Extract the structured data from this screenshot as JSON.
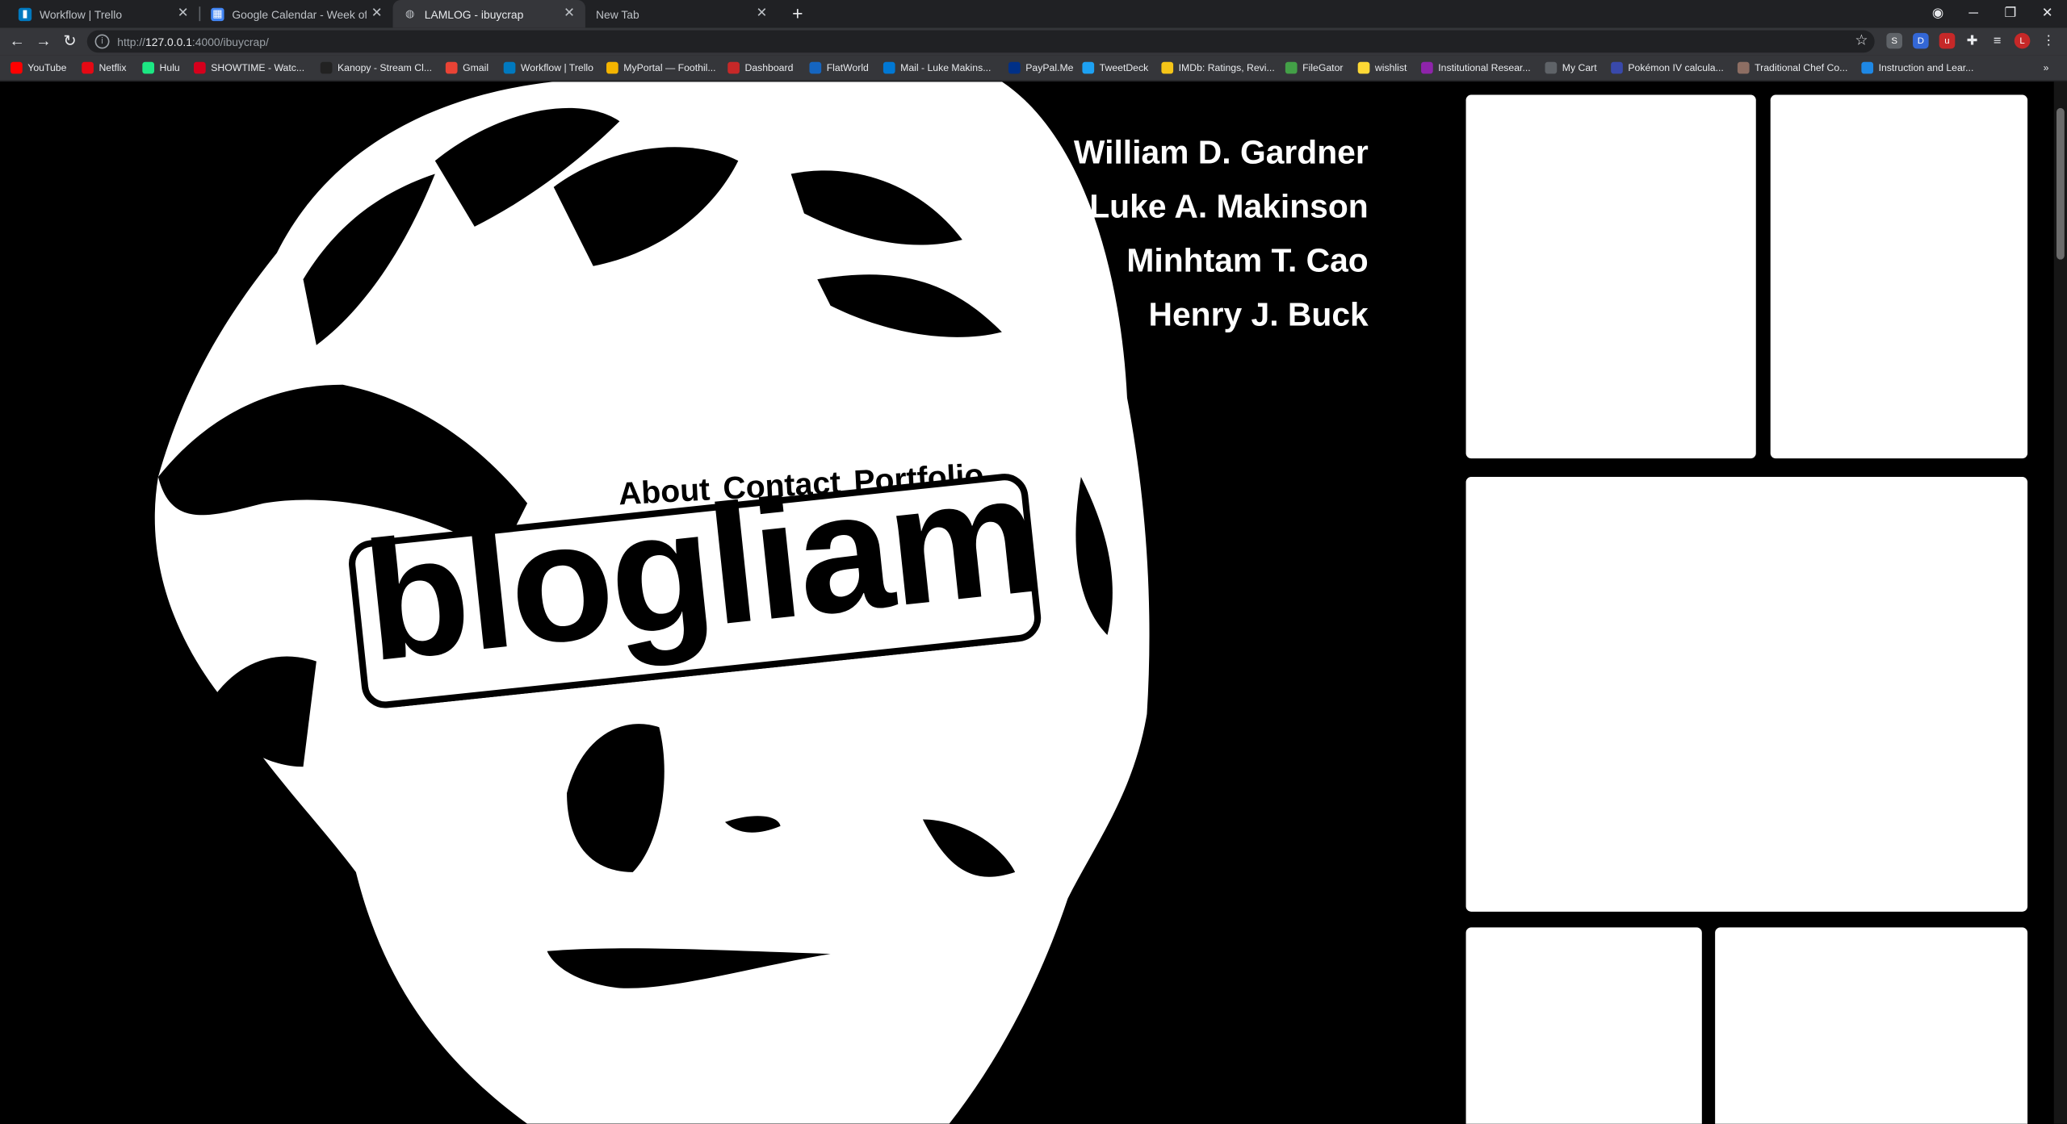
{
  "browser": {
    "tabs": [
      {
        "title": "Workflow | Trello",
        "active": false
      },
      {
        "title": "Google Calendar - Week of April",
        "active": false
      },
      {
        "title": "LAMLOG - ibuycrap",
        "active": true
      },
      {
        "title": "New Tab",
        "active": false
      }
    ],
    "url_host": "127.0.0.1",
    "url_rest": ":4000/ibuycrap/",
    "url_prefix": "http://",
    "bookmarks": [
      {
        "label": "YouTube",
        "color": "#ff0000"
      },
      {
        "label": "Netflix",
        "color": "#e50914"
      },
      {
        "label": "Hulu",
        "color": "#1ce783"
      },
      {
        "label": "SHOWTIME - Watc...",
        "color": "#d6001c"
      },
      {
        "label": "Kanopy - Stream Cl...",
        "color": "#222222"
      },
      {
        "label": "Gmail",
        "color": "#ea4335"
      },
      {
        "label": "Workflow | Trello",
        "color": "#0079bf"
      },
      {
        "label": "MyPortal — Foothil...",
        "color": "#f4b400"
      },
      {
        "label": "Dashboard",
        "color": "#c62828"
      },
      {
        "label": "FlatWorld",
        "color": "#1565c0"
      },
      {
        "label": "Mail - Luke Makins...",
        "color": "#0078d4"
      },
      {
        "label": "PayPal.Me",
        "color": "#003087"
      },
      {
        "label": "TweetDeck",
        "color": "#1da1f2"
      },
      {
        "label": "IMDb: Ratings, Revi...",
        "color": "#f5c518"
      },
      {
        "label": "FileGator",
        "color": "#43a047"
      },
      {
        "label": "wishlist",
        "color": "#fdd835"
      },
      {
        "label": "Institutional Resear...",
        "color": "#8e24aa"
      },
      {
        "label": "My Cart",
        "color": "#5f6368"
      },
      {
        "label": "Pokémon IV calcula...",
        "color": "#3949ab"
      },
      {
        "label": "Traditional Chef Co...",
        "color": "#8d6e63"
      },
      {
        "label": "Instruction and Lear...",
        "color": "#1e88e5"
      }
    ],
    "more_bookmarks": "»"
  },
  "site": {
    "authors": [
      "William D. Gardner",
      "Luke A. Makinson",
      "Minhtam T. Cao",
      "Henry J. Buck"
    ],
    "nav": [
      "About",
      "Contact",
      "Portfolio"
    ],
    "logo": "blogliam"
  },
  "colors": {
    "page_background": "#000000",
    "card": "#ffffff",
    "text": "#ffffff"
  }
}
